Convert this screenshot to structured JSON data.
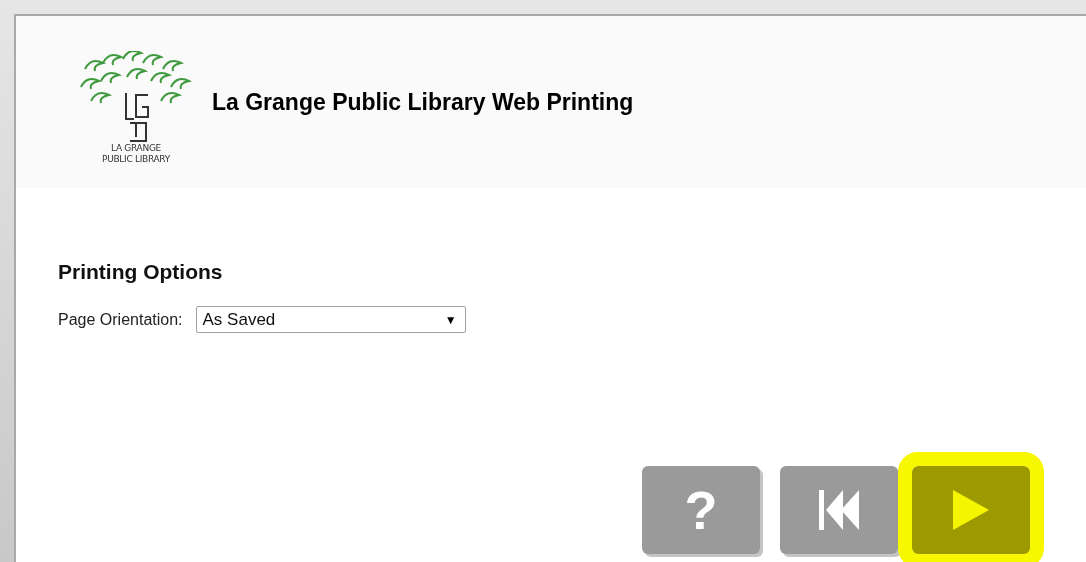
{
  "header": {
    "logo_text": [
      "LA GRANGE",
      "PUBLIC LIBRARY"
    ],
    "title": "La Grange Public Library Web Printing"
  },
  "printing_options": {
    "heading": "Printing Options",
    "label": "Page Orientation:",
    "select_value": "As Saved",
    "select_arrow": "▼"
  },
  "buttons": [
    {
      "kind": "help",
      "label": "?",
      "highlighted": false
    },
    {
      "kind": "back",
      "highlighted": false
    },
    {
      "kind": "next",
      "highlighted": true
    }
  ]
}
